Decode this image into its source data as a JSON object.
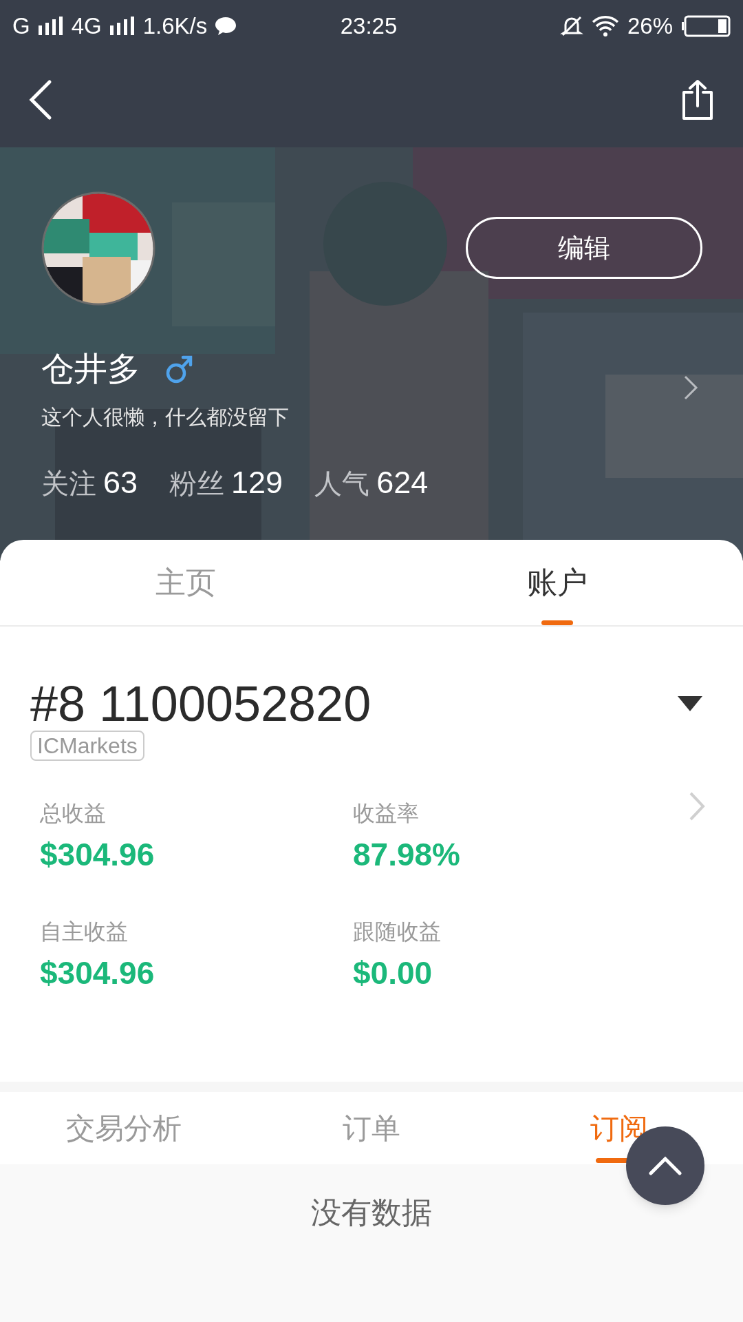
{
  "status_bar": {
    "network_1": "G",
    "network_2": "4G",
    "speed": "1.6K/s",
    "time": "23:25",
    "battery": "26%"
  },
  "profile": {
    "edit_button": "编辑",
    "name": "仓井多",
    "bio": "这个人很懒，什么都没留下",
    "stats": [
      {
        "label": "关注",
        "value": "63"
      },
      {
        "label": "粉丝",
        "value": "129"
      },
      {
        "label": "人气",
        "value": "624"
      }
    ]
  },
  "tabs": [
    {
      "label": "主页",
      "selected": false
    },
    {
      "label": "账户",
      "selected": true
    }
  ],
  "account": {
    "number": "#8 1100052820",
    "broker": "ICMarkets",
    "metrics": [
      {
        "label": "总收益",
        "value": "$304.96"
      },
      {
        "label": "收益率",
        "value": "87.98%"
      },
      {
        "label": "自主收益",
        "value": "$304.96"
      },
      {
        "label": "跟随收益",
        "value": "$0.00"
      }
    ]
  },
  "sub_tabs": [
    {
      "label": "交易分析",
      "selected": false
    },
    {
      "label": "订单",
      "selected": false
    },
    {
      "label": "订阅",
      "selected": true
    }
  ],
  "empty_message": "没有数据"
}
